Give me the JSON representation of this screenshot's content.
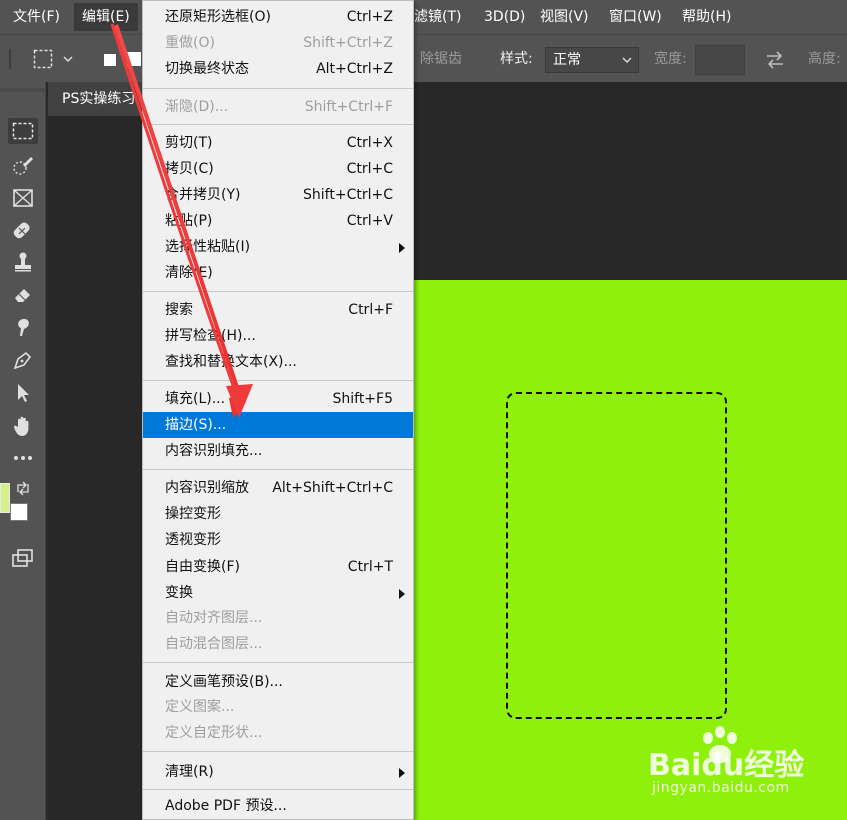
{
  "menubar": {
    "items": [
      {
        "label": "文件(F)"
      },
      {
        "label": "编辑(E)"
      },
      {
        "label": "滤镜(T)"
      },
      {
        "label": "3D(D)"
      },
      {
        "label": "视图(V)"
      },
      {
        "label": "窗口(W)"
      },
      {
        "label": "帮助(H)"
      }
    ]
  },
  "options": {
    "anti_alias_label": "除锯齿",
    "style_label": "样式:",
    "style_value": "正常",
    "width_label": "宽度:",
    "height_label": "高度:"
  },
  "document": {
    "tab_title": "PS实操练习"
  },
  "edit_menu": {
    "items": [
      {
        "label": "还原矩形选框(O)",
        "shortcut": "Ctrl+Z"
      },
      {
        "label": "重做(O)",
        "shortcut": "Shift+Ctrl+Z"
      },
      {
        "label": "切换最终状态",
        "shortcut": "Alt+Ctrl+Z"
      },
      {
        "label": "渐隐(D)...",
        "shortcut": "Shift+Ctrl+F"
      },
      {
        "label": "剪切(T)",
        "shortcut": "Ctrl+X"
      },
      {
        "label": "拷贝(C)",
        "shortcut": "Ctrl+C"
      },
      {
        "label": "合并拷贝(Y)",
        "shortcut": "Shift+Ctrl+C"
      },
      {
        "label": "粘贴(P)",
        "shortcut": "Ctrl+V"
      },
      {
        "label": "选择性粘贴(I)",
        "shortcut": ""
      },
      {
        "label": "清除(E)",
        "shortcut": ""
      },
      {
        "label": "搜索",
        "shortcut": "Ctrl+F"
      },
      {
        "label": "拼写检查(H)...",
        "shortcut": ""
      },
      {
        "label": "查找和替换文本(X)...",
        "shortcut": ""
      },
      {
        "label": "填充(L)...",
        "shortcut": "Shift+F5"
      },
      {
        "label": "描边(S)...",
        "shortcut": ""
      },
      {
        "label": "内容识别填充...",
        "shortcut": ""
      },
      {
        "label": "内容识别缩放",
        "shortcut": "Alt+Shift+Ctrl+C"
      },
      {
        "label": "操控变形",
        "shortcut": ""
      },
      {
        "label": "透视变形",
        "shortcut": ""
      },
      {
        "label": "自由变换(F)",
        "shortcut": "Ctrl+T"
      },
      {
        "label": "变换",
        "shortcut": ""
      },
      {
        "label": "自动对齐图层...",
        "shortcut": ""
      },
      {
        "label": "自动混合图层...",
        "shortcut": ""
      },
      {
        "label": "定义画笔预设(B)...",
        "shortcut": ""
      },
      {
        "label": "定义图案...",
        "shortcut": ""
      },
      {
        "label": "定义自定形状...",
        "shortcut": ""
      },
      {
        "label": "清理(R)",
        "shortcut": ""
      },
      {
        "label": "Adobe PDF 预设...",
        "shortcut": ""
      }
    ]
  },
  "watermark": {
    "brand": "Baidu经验",
    "url": "jingyan.baidu.com"
  },
  "colors": {
    "menu_bg": "#535353",
    "canvas_fill": "#8ff00c",
    "highlight": "#0078d7",
    "arrow": "#f03a3a",
    "foreground_swatch": "#d4f08a",
    "background_swatch": "#ffffff"
  },
  "icons": [
    "marquee-icon",
    "quick-select-icon",
    "frame-icon",
    "healing-brush-icon",
    "stamp-icon",
    "eraser-icon",
    "smudge-icon",
    "pen-icon",
    "selection-arrow-icon",
    "hand-icon",
    "more-tools-icon",
    "swap-colors-icon",
    "screen-mode-icon",
    "swap-arrows-icon",
    "submenu-arrow-icon"
  ]
}
